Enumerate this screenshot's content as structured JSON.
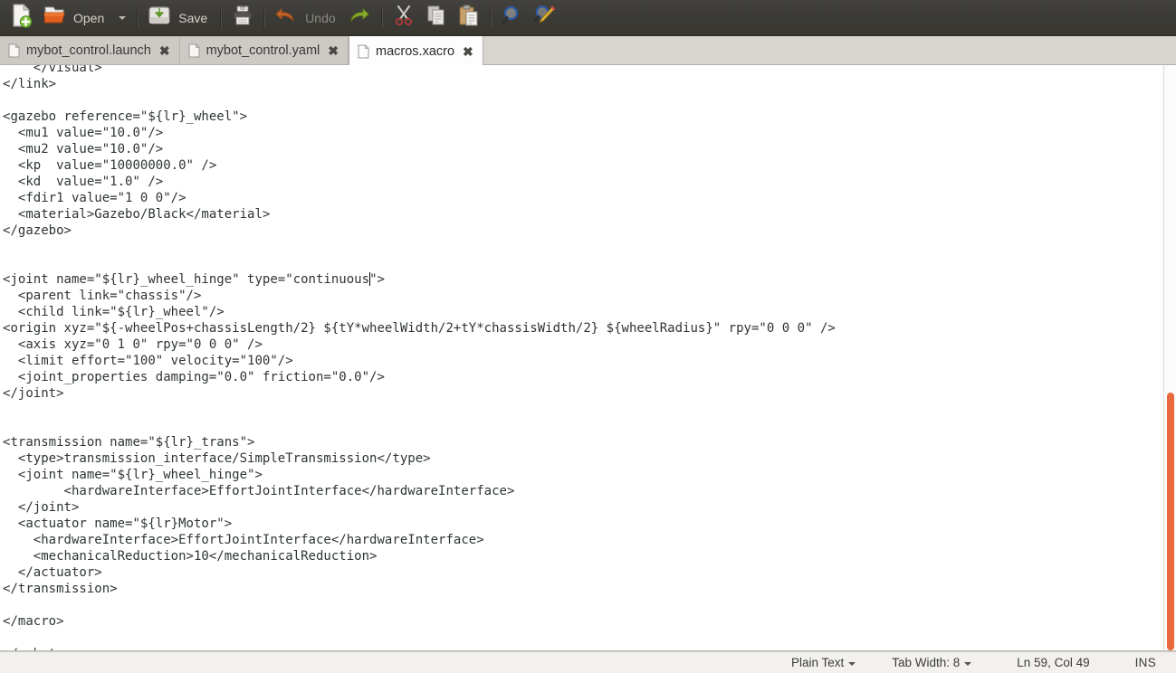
{
  "toolbar": {
    "items": [
      {
        "name": "new-document",
        "icon": "new-document-icon",
        "label": ""
      },
      {
        "name": "open",
        "icon": "open-folder-icon",
        "label": "Open"
      },
      {
        "name": "open-dropdown",
        "icon": "chevron-down-icon",
        "label": ""
      },
      {
        "name": "save",
        "icon": "save-disk-icon",
        "label": "Save"
      },
      {
        "name": "print",
        "icon": "printer-icon",
        "label": ""
      },
      {
        "name": "undo",
        "icon": "undo-arrow-icon",
        "label": "Undo"
      },
      {
        "name": "redo",
        "icon": "redo-arrow-icon",
        "label": ""
      },
      {
        "name": "cut",
        "icon": "scissors-icon",
        "label": ""
      },
      {
        "name": "copy",
        "icon": "copy-pages-icon",
        "label": ""
      },
      {
        "name": "paste",
        "icon": "clipboard-paste-icon",
        "label": ""
      },
      {
        "name": "find",
        "icon": "magnifier-icon",
        "label": ""
      },
      {
        "name": "find-replace",
        "icon": "magnifier-pencil-icon",
        "label": ""
      }
    ],
    "open_label": "Open",
    "save_label": "Save",
    "undo_label": "Undo"
  },
  "tabs": [
    {
      "title": "mybot_control.launch",
      "active": false,
      "close": "✖"
    },
    {
      "title": "mybot_control.yaml",
      "active": false,
      "close": "✖"
    },
    {
      "title": "macros.xacro",
      "active": true,
      "close": "✖"
    }
  ],
  "editor": {
    "filename": "macros.xacro",
    "code_before_caret": "    </visual>\n</link>\n\n<gazebo reference=\"${lr}_wheel\">\n  <mu1 value=\"10.0\"/>\n  <mu2 value=\"10.0\"/>\n  <kp  value=\"10000000.0\" />\n  <kd  value=\"1.0\" />\n  <fdir1 value=\"1 0 0\"/>\n  <material>Gazebo/Black</material>\n</gazebo>\n\n\n<joint name=\"${lr}_wheel_hinge\" type=\"continuous",
    "code_after_caret": "\">\n  <parent link=\"chassis\"/>\n  <child link=\"${lr}_wheel\"/>\n<origin xyz=\"${-wheelPos+chassisLength/2} ${tY*wheelWidth/2+tY*chassisWidth/2} ${wheelRadius}\" rpy=\"0 0 0\" />\n  <axis xyz=\"0 1 0\" rpy=\"0 0 0\" />\n  <limit effort=\"100\" velocity=\"100\"/>\n  <joint_properties damping=\"0.0\" friction=\"0.0\"/>\n</joint>\n\n\n<transmission name=\"${lr}_trans\">\n  <type>transmission_interface/SimpleTransmission</type>\n  <joint name=\"${lr}_wheel_hinge\">\n        <hardwareInterface>EffortJointInterface</hardwareInterface>\n  </joint>\n  <actuator name=\"${lr}Motor\">\n    <hardwareInterface>EffortJointInterface</hardwareInterface>\n    <mechanicalReduction>10</mechanicalReduction>\n  </actuator>\n</transmission>\n\n</macro>\n\n</robot>",
    "scrollbar": {
      "thumb_top_pct": 56,
      "thumb_height_pct": 44,
      "color": "#e8693d"
    }
  },
  "statusbar": {
    "language": "Plain Text",
    "tab_width": "Tab Width: 8",
    "position": "Ln 59, Col 49",
    "insert_mode": "INS"
  },
  "colors": {
    "toolbar_bg": "#3b3a36",
    "tabbar_bg": "#d8d4d0",
    "active_tab_bg": "#fdfdfd",
    "editor_bg": "#ffffff",
    "text": "#2e3436",
    "statusbar_bg": "#f2f1ef",
    "accent_orange": "#e8693d"
  }
}
